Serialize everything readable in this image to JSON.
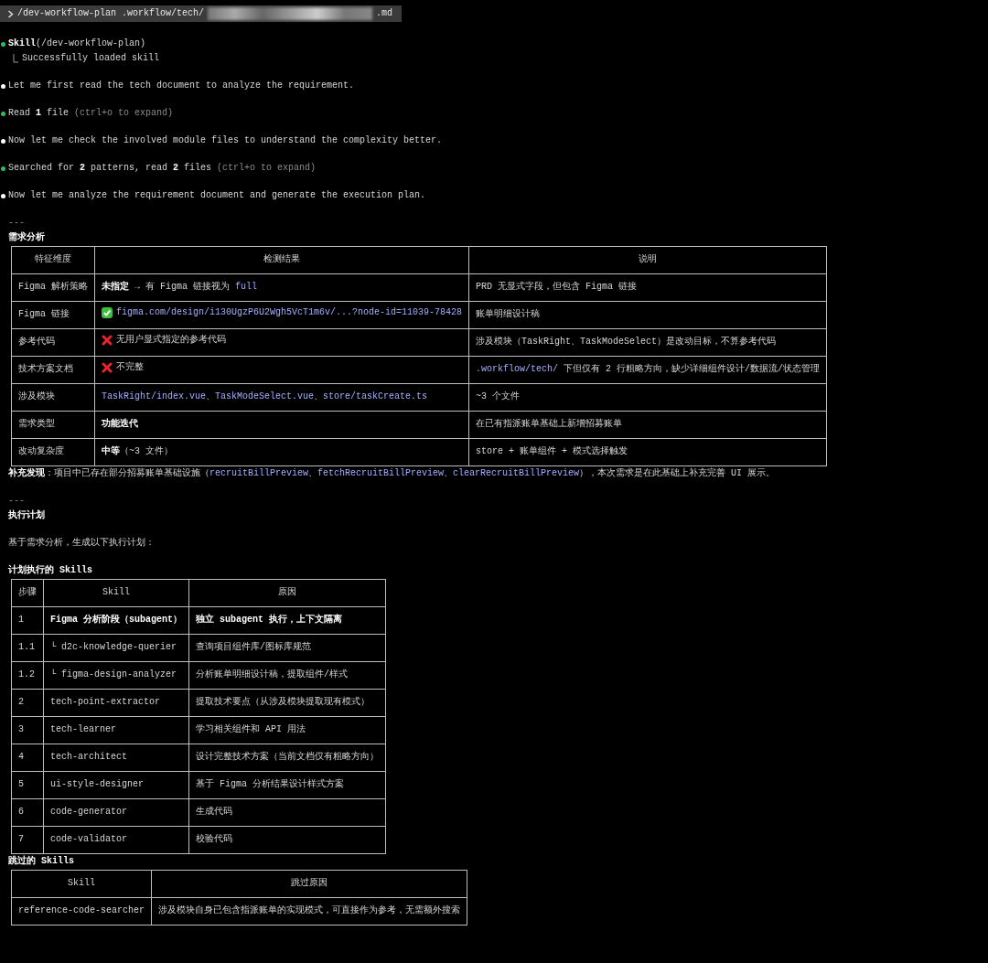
{
  "command": {
    "text": "/dev-workflow-plan .workflow/tech/",
    "redacted": true,
    "suffix": ".md"
  },
  "transcript": [
    {
      "kind": "tool",
      "segments": [
        {
          "text": "Skill",
          "kind": "bold"
        },
        {
          "text": "(/dev-workflow-plan)",
          "kind": "plain"
        }
      ],
      "result": "Successfully loaded skill"
    },
    {
      "kind": "message",
      "segments": [
        {
          "text": "Let me first read the tech document to analyze the requirement.",
          "kind": "plain"
        }
      ]
    },
    {
      "kind": "tool",
      "segments": [
        {
          "text": "Read ",
          "kind": "plain"
        },
        {
          "text": "1",
          "kind": "bold"
        },
        {
          "text": " file ",
          "kind": "plain"
        },
        {
          "text": "(ctrl+o to expand)",
          "kind": "dim"
        }
      ]
    },
    {
      "kind": "message",
      "segments": [
        {
          "text": "Now let me check the involved module files to understand the complexity better.",
          "kind": "plain"
        }
      ]
    },
    {
      "kind": "tool",
      "segments": [
        {
          "text": "Searched for ",
          "kind": "plain"
        },
        {
          "text": "2",
          "kind": "bold"
        },
        {
          "text": " patterns, read ",
          "kind": "plain"
        },
        {
          "text": "2",
          "kind": "bold"
        },
        {
          "text": " files ",
          "kind": "plain"
        },
        {
          "text": "(ctrl+o to expand)",
          "kind": "dim"
        }
      ]
    },
    {
      "kind": "message",
      "segments": [
        {
          "text": "Now let me analyze the requirement document and generate the execution plan.",
          "kind": "plain"
        }
      ]
    }
  ],
  "blocks": [
    {
      "kind": "rule",
      "text": "---"
    },
    {
      "kind": "heading",
      "text": "需求分析"
    },
    {
      "kind": "table",
      "columns": [
        "特征维度",
        "检测结果",
        "说明"
      ],
      "rows": [
        [
          {
            "segments": [
              {
                "text": "Figma 解析策略",
                "kind": "plain"
              }
            ]
          },
          {
            "segments": [
              {
                "text": "未指定",
                "kind": "bold"
              },
              {
                "text": " → 有 Figma 链接视为 ",
                "kind": "plain"
              },
              {
                "text": "full",
                "kind": "code"
              }
            ]
          },
          {
            "segments": [
              {
                "text": "PRD 无显式字段，但包含 Figma 链接",
                "kind": "plain"
              }
            ]
          }
        ],
        [
          {
            "segments": [
              {
                "text": "Figma 链接",
                "kind": "plain"
              }
            ]
          },
          {
            "passed": true,
            "segments": [
              {
                "text": "figma.com/design/i130UgzP6U2Wgh5VcT1m6v/...?node-id=11039-78428",
                "kind": "code"
              }
            ]
          },
          {
            "segments": [
              {
                "text": "账单明细设计稿",
                "kind": "plain"
              }
            ]
          }
        ],
        [
          {
            "segments": [
              {
                "text": "参考代码",
                "kind": "plain"
              }
            ]
          },
          {
            "passed": false,
            "segments": [
              {
                "text": "无用户显式指定的参考代码",
                "kind": "plain"
              }
            ]
          },
          {
            "segments": [
              {
                "text": "涉及模块（TaskRight、TaskModeSelect）是改动目标，不算参考代码",
                "kind": "plain"
              }
            ]
          }
        ],
        [
          {
            "segments": [
              {
                "text": "技术方案文档",
                "kind": "plain"
              }
            ]
          },
          {
            "passed": false,
            "segments": [
              {
                "text": "不完整",
                "kind": "plain"
              }
            ]
          },
          {
            "segments": [
              {
                "text": ".workflow/tech/",
                "kind": "code"
              },
              {
                "text": " 下但仅有 2 行粗略方向，缺少详细组件设计/数据流/状态管理",
                "kind": "plain"
              }
            ]
          }
        ],
        [
          {
            "segments": [
              {
                "text": "涉及模块",
                "kind": "plain"
              }
            ]
          },
          {
            "segments": [
              {
                "text": "TaskRight/index.vue",
                "kind": "code"
              },
              {
                "text": "、",
                "kind": "plain"
              },
              {
                "text": "TaskModeSelect.vue",
                "kind": "code"
              },
              {
                "text": "、",
                "kind": "plain"
              },
              {
                "text": "store/taskCreate.ts",
                "kind": "code"
              }
            ]
          },
          {
            "segments": [
              {
                "text": "~3 个文件",
                "kind": "plain"
              }
            ]
          }
        ],
        [
          {
            "segments": [
              {
                "text": "需求类型",
                "kind": "plain"
              }
            ]
          },
          {
            "segments": [
              {
                "text": "功能迭代",
                "kind": "bold"
              }
            ]
          },
          {
            "segments": [
              {
                "text": "在已有指派账单基础上新增招募账单",
                "kind": "plain"
              }
            ]
          }
        ],
        [
          {
            "segments": [
              {
                "text": "改动复杂度",
                "kind": "plain"
              }
            ]
          },
          {
            "segments": [
              {
                "text": "中等",
                "kind": "bold"
              },
              {
                "text": "（~3 文件）",
                "kind": "plain"
              }
            ]
          },
          {
            "segments": [
              {
                "text": "store + 账单组件 + 模式选择触发",
                "kind": "plain"
              }
            ]
          }
        ]
      ]
    },
    {
      "kind": "paragraph",
      "segments": [
        {
          "text": "补充发现",
          "kind": "bold"
        },
        {
          "text": "：项目中已存在部分招募账单基础设施（",
          "kind": "plain"
        },
        {
          "text": "recruitBillPreview",
          "kind": "code"
        },
        {
          "text": "、",
          "kind": "plain"
        },
        {
          "text": "fetchRecruitBillPreview",
          "kind": "code"
        },
        {
          "text": "、",
          "kind": "plain"
        },
        {
          "text": "clearRecruitBillPreview",
          "kind": "code"
        },
        {
          "text": "），本次需求是在此基础上补充完善 UI 展示。",
          "kind": "plain"
        }
      ]
    },
    {
      "kind": "rule",
      "text": "---"
    },
    {
      "kind": "heading",
      "text": "执行计划"
    },
    {
      "kind": "paragraph",
      "segments": [
        {
          "text": "基于需求分析，生成以下执行计划：",
          "kind": "plain"
        }
      ]
    },
    {
      "kind": "heading",
      "text": "计划执行的 Skills"
    },
    {
      "kind": "table",
      "columns": [
        "步骤",
        "Skill",
        "原因"
      ],
      "rows": [
        [
          {
            "segments": [
              {
                "text": "1",
                "kind": "plain"
              }
            ]
          },
          {
            "segments": [
              {
                "text": "Figma 分析阶段（subagent）",
                "kind": "bold"
              }
            ]
          },
          {
            "segments": [
              {
                "text": "独立 subagent 执行，上下文隔离",
                "kind": "bold"
              }
            ]
          }
        ],
        [
          {
            "segments": [
              {
                "text": "1.1",
                "kind": "plain"
              }
            ]
          },
          {
            "segments": [
              {
                "text": "└ d2c-knowledge-querier",
                "kind": "plain"
              }
            ]
          },
          {
            "segments": [
              {
                "text": "查询项目组件库/图标库规范",
                "kind": "plain"
              }
            ]
          }
        ],
        [
          {
            "segments": [
              {
                "text": "1.2",
                "kind": "plain"
              }
            ]
          },
          {
            "segments": [
              {
                "text": "└ figma-design-analyzer",
                "kind": "plain"
              }
            ]
          },
          {
            "segments": [
              {
                "text": "分析账单明细设计稿，提取组件/样式",
                "kind": "plain"
              }
            ]
          }
        ],
        [
          {
            "segments": [
              {
                "text": "2",
                "kind": "plain"
              }
            ]
          },
          {
            "segments": [
              {
                "text": "tech-point-extractor",
                "kind": "plain"
              }
            ]
          },
          {
            "segments": [
              {
                "text": "提取技术要点（从涉及模块提取现有模式）",
                "kind": "plain"
              }
            ]
          }
        ],
        [
          {
            "segments": [
              {
                "text": "3",
                "kind": "plain"
              }
            ]
          },
          {
            "segments": [
              {
                "text": "tech-learner",
                "kind": "plain"
              }
            ]
          },
          {
            "segments": [
              {
                "text": "学习相关组件和 API 用法",
                "kind": "plain"
              }
            ]
          }
        ],
        [
          {
            "segments": [
              {
                "text": "4",
                "kind": "plain"
              }
            ]
          },
          {
            "segments": [
              {
                "text": "tech-architect",
                "kind": "plain"
              }
            ]
          },
          {
            "segments": [
              {
                "text": "设计完整技术方案（当前文档仅有粗略方向）",
                "kind": "plain"
              }
            ]
          }
        ],
        [
          {
            "segments": [
              {
                "text": "5",
                "kind": "plain"
              }
            ]
          },
          {
            "segments": [
              {
                "text": "ui-style-designer",
                "kind": "plain"
              }
            ]
          },
          {
            "segments": [
              {
                "text": "基于 Figma 分析结果设计样式方案",
                "kind": "plain"
              }
            ]
          }
        ],
        [
          {
            "segments": [
              {
                "text": "6",
                "kind": "plain"
              }
            ]
          },
          {
            "segments": [
              {
                "text": "code-generator",
                "kind": "plain"
              }
            ]
          },
          {
            "segments": [
              {
                "text": "生成代码",
                "kind": "plain"
              }
            ]
          }
        ],
        [
          {
            "segments": [
              {
                "text": "7",
                "kind": "plain"
              }
            ]
          },
          {
            "segments": [
              {
                "text": "code-validator",
                "kind": "plain"
              }
            ]
          },
          {
            "segments": [
              {
                "text": "校验代码",
                "kind": "plain"
              }
            ]
          }
        ]
      ]
    },
    {
      "kind": "heading",
      "text": "跳过的 Skills"
    },
    {
      "kind": "table",
      "columns": [
        "Skill",
        "跳过原因"
      ],
      "rows": [
        [
          {
            "segments": [
              {
                "text": "reference-code-searcher",
                "kind": "plain"
              }
            ]
          },
          {
            "segments": [
              {
                "text": "涉及模块自身已包含指派账单的实现模式，可直接作为参考，无需额外搜索",
                "kind": "plain"
              }
            ]
          }
        ]
      ]
    }
  ]
}
